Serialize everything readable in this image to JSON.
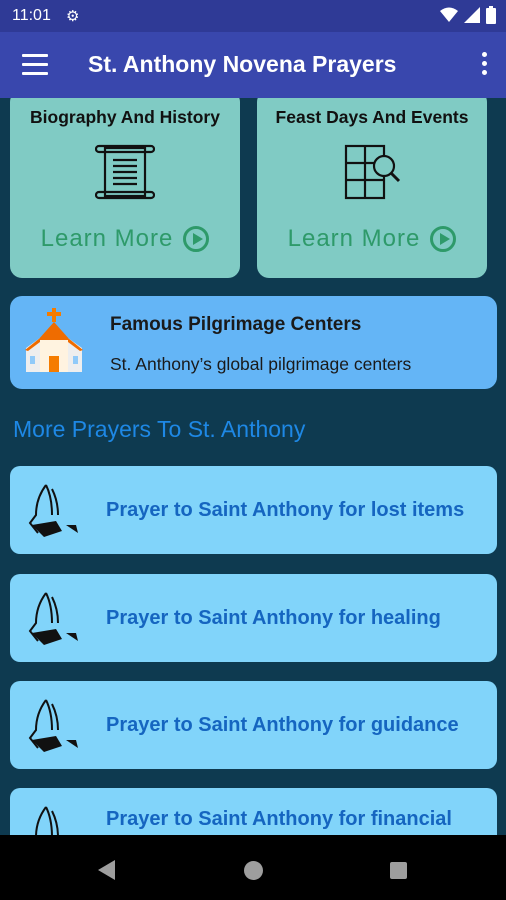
{
  "status_bar": {
    "time": "11:01",
    "icons": [
      "settings-icon",
      "wifi-icon",
      "signal-icon",
      "battery-icon"
    ]
  },
  "app_bar": {
    "title": "St. Anthony Novena Prayers",
    "menu_icon": "hamburger-menu-icon",
    "more_icon": "more-vert-icon"
  },
  "tiles": [
    {
      "title": "Biography And History",
      "icon": "scroll-icon",
      "action": "Learn More"
    },
    {
      "title": "Feast Days And Events",
      "icon": "calendar-search-icon",
      "action": "Learn More"
    }
  ],
  "pilgrimage": {
    "title": "Famous Pilgrimage Centers",
    "subtitle": "St. Anthony’s global pilgrimage centers",
    "icon": "church-icon"
  },
  "section_title": "More Prayers To St. Anthony",
  "prayers": [
    {
      "label": "Prayer to Saint Anthony for lost items"
    },
    {
      "label": "Prayer to Saint Anthony for healing"
    },
    {
      "label": "Prayer to Saint Anthony for guidance"
    },
    {
      "label": "Prayer to Saint Anthony for financial"
    }
  ],
  "nav_bar": {
    "buttons": [
      "back",
      "home",
      "recents"
    ]
  },
  "colors": {
    "app_bar": "#3947ad",
    "background": "#0e3a50",
    "tile": "#80cbc4",
    "pilgrimage_card": "#64b5f6",
    "prayer_card": "#81d4fa",
    "prayer_text": "#1565c0",
    "section_title": "#1e88e5",
    "learn_more": "#2e9a6a"
  }
}
